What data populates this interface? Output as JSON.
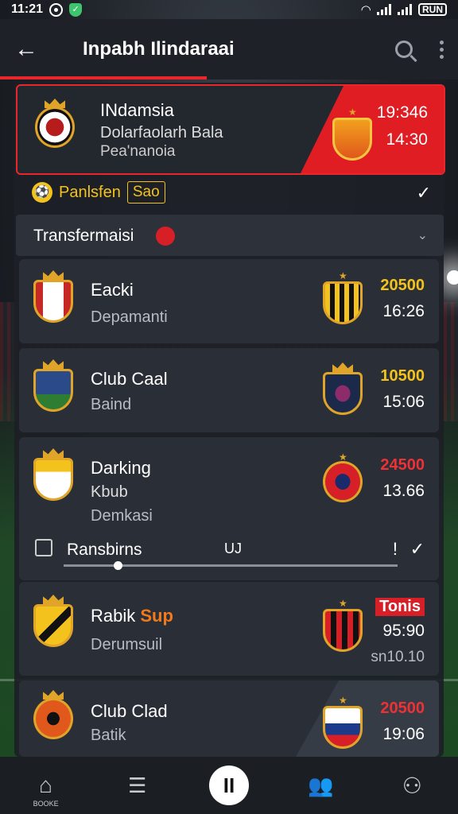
{
  "status_bar": {
    "time": "11:21",
    "battery": "RUN"
  },
  "header": {
    "title": "Inpabh Ilindaraai"
  },
  "featured": {
    "name": "INdamsia",
    "line1": "Dolarfaolarh Bala",
    "line2": "Pea'nanoia",
    "time1": "19:346",
    "time2": "14:30"
  },
  "filter": {
    "label": "Panlsfen",
    "box": "Sao"
  },
  "section": {
    "label": "Transfermaisi"
  },
  "cards": [
    {
      "name": "Eacki",
      "sub": "Depamanti",
      "v1": "20500",
      "v2": "16:26"
    },
    {
      "name": "Club Caal",
      "sub": "Baind",
      "v1": "10500",
      "v2": "15:06"
    },
    {
      "name": "Darking",
      "sub": "Kbub",
      "sub2": "Demkasi",
      "v1": "24500",
      "v2": "13.66"
    },
    {
      "name": "Rabik",
      "tag": "Sup",
      "sub": "Derumsuil",
      "v1": "Tonis",
      "v2": "95:90",
      "v3": "sn10.10"
    },
    {
      "name": "Club Clad",
      "sub": "Batik",
      "v1": "20500",
      "v2": "19:06"
    }
  ],
  "slider": {
    "label": "Ransbirns",
    "value": "UJ",
    "position": 0.15
  },
  "nav": {
    "home_label": "BOOKE",
    "center_label": "II"
  },
  "colors": {
    "accent": "#e8262b",
    "highlight": "#f4c21c",
    "card": "#2a2f37"
  }
}
